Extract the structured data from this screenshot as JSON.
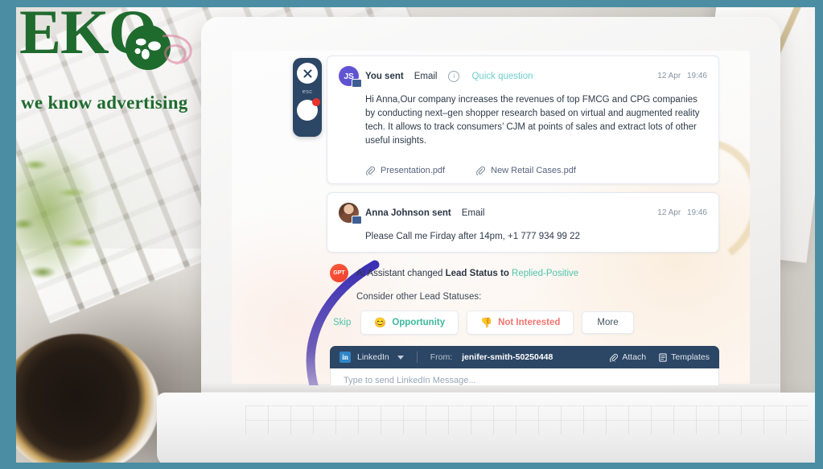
{
  "branding": {
    "logo_text": "EKO",
    "tagline": "we know advertising"
  },
  "widget": {
    "close_label": "✕",
    "esc_label": "esc"
  },
  "messages": [
    {
      "avatar_initials": "JS",
      "sender": "You sent",
      "channel": "Email",
      "subject": "Quick question",
      "date": "12 Apr",
      "time": "19:46",
      "body": "Hi Anna,Our company increases the revenues of top FMCG and CPG companies by conducting next–gen shopper research based on virtual and augmented reality tech. It allows to track consumers’ CJM at points of sales and extract lots of other useful insights.",
      "attachments": [
        {
          "icon": "paperclip-icon",
          "name": "Presentation.pdf"
        },
        {
          "icon": "paperclip-icon",
          "name": "New Retail Cases.pdf"
        }
      ]
    },
    {
      "sender": "Anna Johnson sent",
      "channel": "Email",
      "date": "12 Apr",
      "time": "19:46",
      "body": "Please Call me Firday after 14pm, +1 777 934 99 22"
    }
  ],
  "ai_assistant": {
    "avatar_label": "GPT",
    "text_prefix": "AI Assistant changed ",
    "text_bold": "Lead Status",
    "text_mid": " to ",
    "status_value": "Replied-Positive",
    "subtext": "Consider other Lead Statuses:",
    "skip_label": "Skip",
    "actions": [
      {
        "emoji": "😊",
        "label": "Opportunity"
      },
      {
        "emoji": "👎",
        "label": "Not Interested"
      },
      {
        "emoji": "",
        "label": "More"
      }
    ]
  },
  "composer": {
    "channel_icon": "linkedin-icon",
    "channel_label": "LinkedIn",
    "from_label": "From:",
    "from_value": "jenifer-smith-50250448",
    "attach_label": "Attach",
    "templates_label": "Templates",
    "input_placeholder": "Type to send LinkedIn Message..."
  },
  "colors": {
    "frame_teal": "#4b8ea3",
    "navy": "#2c4665",
    "teal_accent": "#4fc3ab",
    "subject_teal": "#6fcfd0",
    "red": "#f0402c",
    "not_interested": "#f3756f",
    "linkedin_blue": "#2f86c7",
    "logo_green": "#1f6b2e"
  }
}
